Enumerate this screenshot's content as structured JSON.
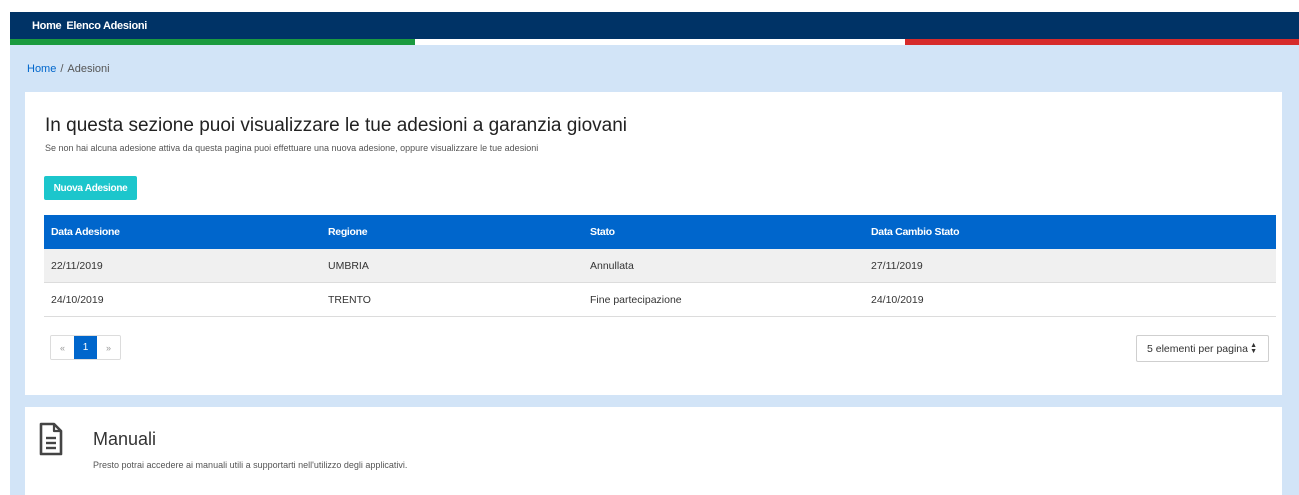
{
  "nav": {
    "items": [
      {
        "label": "Home"
      },
      {
        "label": "Elenco Adesioni"
      }
    ]
  },
  "colors": {
    "navbar": "#003366",
    "flag_green": "#1b9a3f",
    "flag_white": "#ffffff",
    "flag_red": "#d62b2b",
    "accent": "#0066cc",
    "button": "#1cc6cc",
    "page_bg": "#d2e4f7"
  },
  "breadcrumb": {
    "home": "Home",
    "separator": "/",
    "current": "Adesioni"
  },
  "main": {
    "title": "In questa sezione puoi visualizzare le tue adesioni a garanzia giovani",
    "subtitle": "Se non hai alcuna adesione attiva da questa pagina puoi effettuare una nuova adesione, oppure visualizzare le tue adesioni",
    "new_button": "Nuova Adesione"
  },
  "table": {
    "headers": [
      "Data Adesione",
      "Regione",
      "Stato",
      "Data Cambio Stato"
    ],
    "rows": [
      [
        "22/11/2019",
        "UMBRIA",
        "Annullata",
        "27/11/2019"
      ],
      [
        "24/10/2019",
        "TRENTO",
        "Fine partecipazione",
        "24/10/2019"
      ]
    ]
  },
  "pagination": {
    "prev": "«",
    "current_page": "1",
    "next": "»",
    "page_size_selected": "5 elementi per pagina"
  },
  "manuals": {
    "icon": "document-icon",
    "title": "Manuali",
    "text": "Presto potrai accedere ai manuali utili a supportarti nell'utilizzo degli applicativi."
  }
}
